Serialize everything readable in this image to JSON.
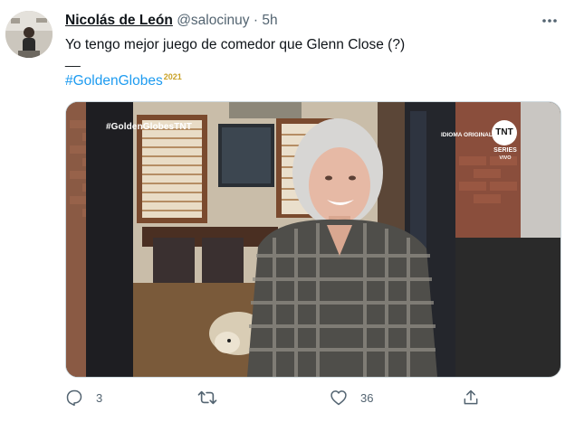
{
  "tweet": {
    "author_name": "Nicolás de León",
    "author_handle": "@salocinuy",
    "separator": "·",
    "time": "5h",
    "more_icon": "more-icon",
    "text_line1": "Yo tengo mejor juego de comedor que Glenn Close (?)",
    "text_line2": "__",
    "hashtag": "#GoldenGlobes",
    "hashtag_flair": "2021"
  },
  "media": {
    "overlay_tag": "#GoldenGlobesTNT",
    "idioma": "IDIOMA ORIGINAL",
    "logo": "TNT",
    "series": "SERIES",
    "vivo": "VIVO"
  },
  "actions": {
    "reply_count": "3",
    "retweet_count": "",
    "like_count": "36"
  },
  "colors": {
    "link": "#1d9bf0",
    "muted": "#536471",
    "text": "#0f1419"
  }
}
